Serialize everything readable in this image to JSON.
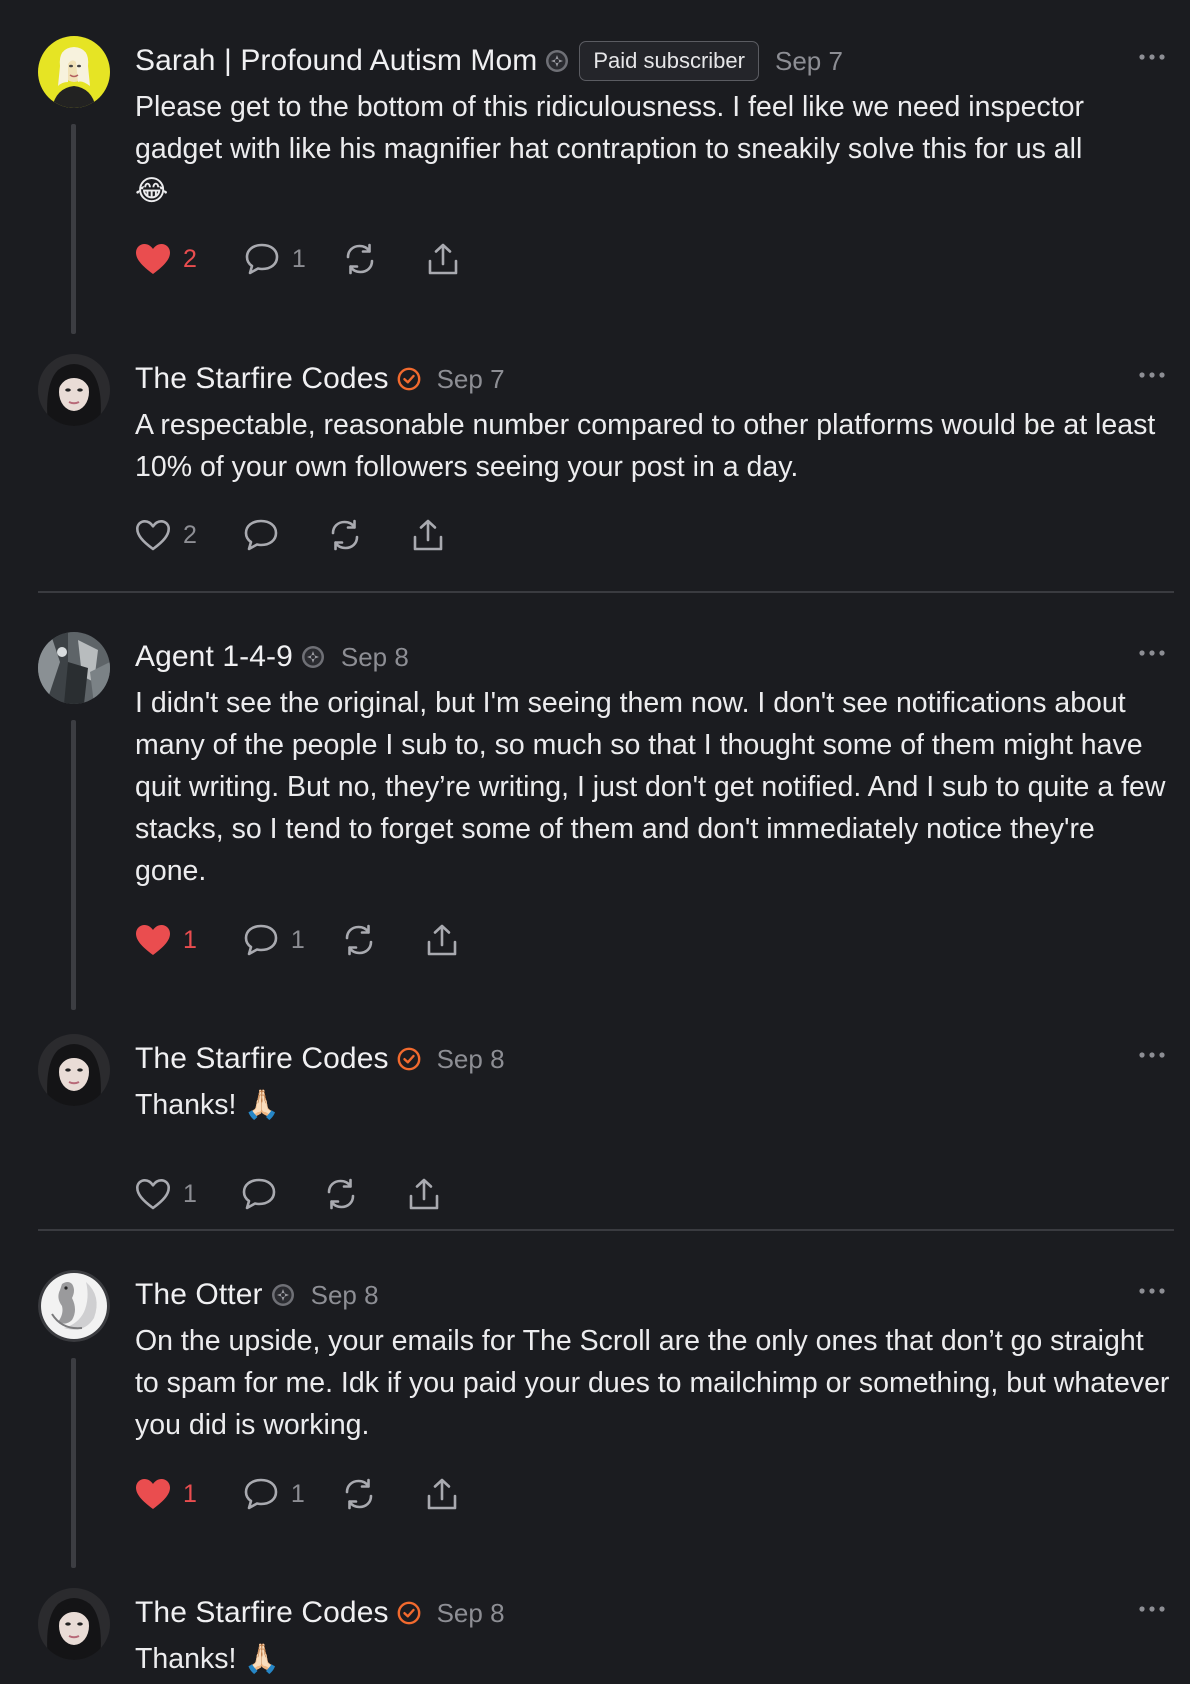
{
  "comments": [
    {
      "author": "Sarah | Profound Autism Mom",
      "badge": "paid subscriber founding badge icon",
      "paid_label": "Paid subscriber",
      "date": "Sep 7",
      "text": "Please get to the bottom of this ridiculousness. I feel like we need inspector gadget with like his magnifier hat contraption to sneakily solve this for us all",
      "emoji": "😂",
      "likes": "2",
      "liked": true,
      "replies": "1"
    },
    {
      "author": "The Starfire Codes",
      "date": "Sep 7",
      "text": "A respectable, reasonable number compared to other platforms would be at least 10% of your own followers seeing your post in a day.",
      "likes": "2",
      "liked": false,
      "replies": ""
    },
    {
      "author": "Agent 1-4-9",
      "date": "Sep 8",
      "text": "I didn't see the original, but I'm seeing them now. I don't see notifications about many of the people I sub to, so much so that I thought some of them might have quit writing. But no, they’re writing, I just don't get notified. And I sub to quite a few stacks, so I tend to forget some of them and don't immediately notice they're gone.",
      "likes": "1",
      "liked": true,
      "replies": "1"
    },
    {
      "author": "The Starfire Codes",
      "date": "Sep 8",
      "text": "Thanks!",
      "emoji": "🙏🏻",
      "likes": "1",
      "liked": false,
      "replies": ""
    },
    {
      "author": "The Otter",
      "date": "Sep 8",
      "text": "On the upside, your emails for The Scroll are the only ones that don’t go straight to spam for me. Idk if you paid your dues to mailchimp or something, but whatever you did is working.",
      "likes": "1",
      "liked": true,
      "replies": "1"
    },
    {
      "author": "The Starfire Codes",
      "date": "Sep 8",
      "text": "Thanks!",
      "emoji": "🙏🏻"
    }
  ],
  "colors": {
    "background": "#1b1c20",
    "heart_red": "#ea4d4f",
    "verified_orange": "#f26a2e",
    "muted": "#8d8e94"
  }
}
